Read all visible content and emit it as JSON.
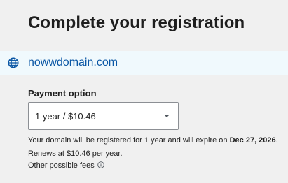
{
  "page": {
    "title": "Complete your registration"
  },
  "domain": {
    "icon": "globe-icon",
    "name": "nowwdomain.com",
    "color": "#0b57a5"
  },
  "payment": {
    "label": "Payment option",
    "selected": "1 year / $10.46",
    "note_prefix": "Your domain will be registered for 1 year and will expire on ",
    "expiry_date": "Dec 27, 2026",
    "note_suffix": ".",
    "renews": "Renews at $10.46 per year.",
    "other_fees": "Other possible fees",
    "other_fees_icon": "info-icon"
  }
}
